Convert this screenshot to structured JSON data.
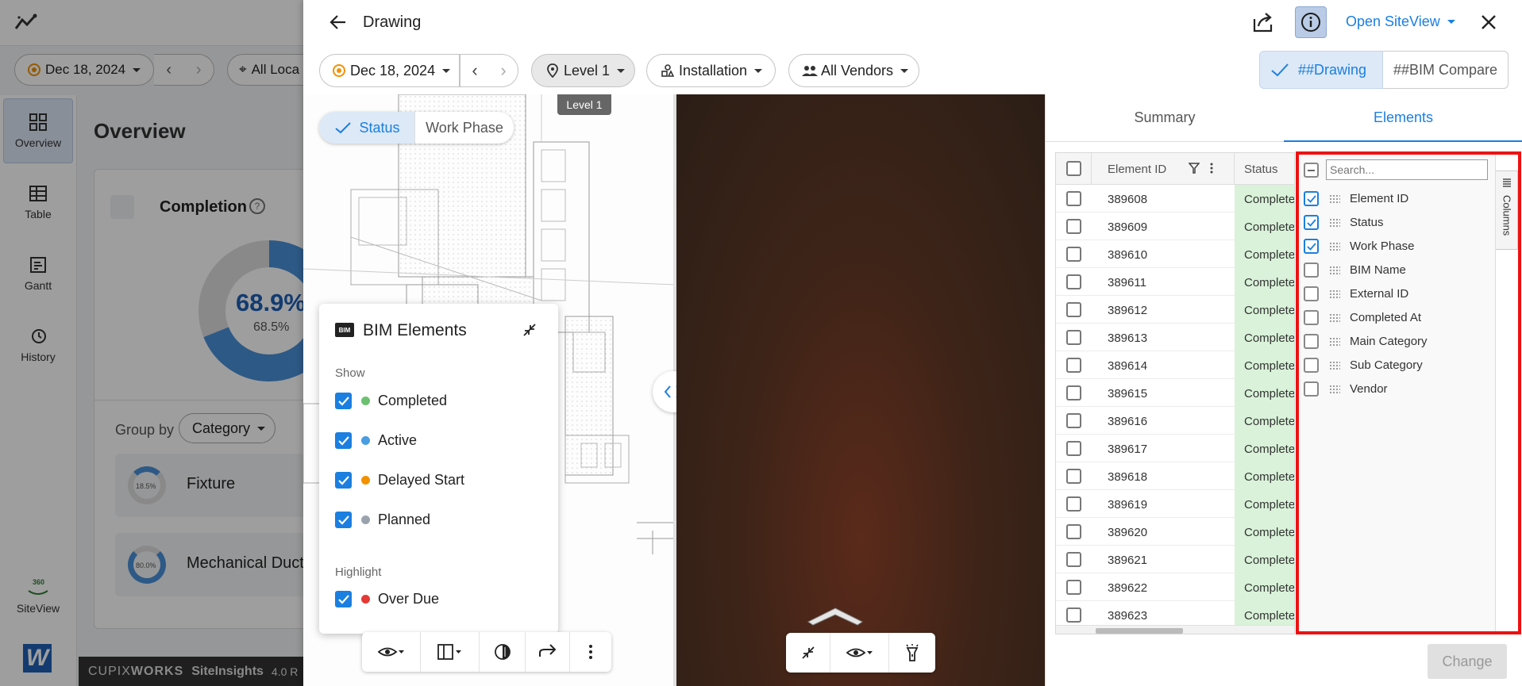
{
  "background": {
    "date": "Dec 18, 2024",
    "location_filter": "All Loca",
    "sidebar": [
      {
        "label": "Overview"
      },
      {
        "label": "Table"
      },
      {
        "label": "Gantt"
      },
      {
        "label": "History"
      },
      {
        "label": "SiteView"
      }
    ],
    "overview_title": "Overview",
    "completion_title": "Completion",
    "completion_percent": "68.9%",
    "completion_sub": "68.5%",
    "group_by_label": "Group by",
    "group_by_value": "Category",
    "groups": [
      {
        "percent": "18.5%",
        "label": "Fixture"
      },
      {
        "percent": "80.0%",
        "label": "Mechanical Duct"
      }
    ],
    "brand": "CUPIXWORKS",
    "brand_cupix": "CUPIX",
    "brand_works": "WORKS",
    "product": "SiteInsights",
    "version": "4.0 R"
  },
  "header": {
    "title": "Drawing",
    "open_siteview": "Open SiteView"
  },
  "toolbar": {
    "date": "Dec 18, 2024",
    "level": "Level 1",
    "installation": "Installation",
    "vendors": "All Vendors",
    "view_drawing": "##Drawing",
    "view_bim_compare": "##BIM Compare"
  },
  "drawing": {
    "level_tag": "Level 1",
    "mode_status": "Status",
    "mode_work_phase": "Work Phase"
  },
  "bim_popover": {
    "badge": "BIM",
    "title": "BIM Elements",
    "show_label": "Show",
    "show_items": [
      {
        "label": "Completed",
        "color": "#6cc070",
        "checked": true
      },
      {
        "label": "Active",
        "color": "#4a9de0",
        "checked": true
      },
      {
        "label": "Delayed Start",
        "color": "#f29100",
        "checked": true
      },
      {
        "label": "Planned",
        "color": "#9aa3ad",
        "checked": true
      }
    ],
    "highlight_label": "Highlight",
    "highlight_items": [
      {
        "label": "Over Due",
        "color": "#e53935",
        "checked": true
      }
    ]
  },
  "right_panel": {
    "tabs": [
      {
        "label": "Summary"
      },
      {
        "label": "Elements"
      }
    ],
    "active_tab": "Elements",
    "columns": {
      "element_id": "Element ID",
      "status": "Status"
    },
    "rows": [
      {
        "id": "389608",
        "status": "Completed"
      },
      {
        "id": "389609",
        "status": "Completed"
      },
      {
        "id": "389610",
        "status": "Completed"
      },
      {
        "id": "389611",
        "status": "Completed"
      },
      {
        "id": "389612",
        "status": "Completed"
      },
      {
        "id": "389613",
        "status": "Completed"
      },
      {
        "id": "389614",
        "status": "Completed"
      },
      {
        "id": "389615",
        "status": "Completed"
      },
      {
        "id": "389616",
        "status": "Completed"
      },
      {
        "id": "389617",
        "status": "Completed"
      },
      {
        "id": "389618",
        "status": "Completed"
      },
      {
        "id": "389619",
        "status": "Completed"
      },
      {
        "id": "389620",
        "status": "Completed"
      },
      {
        "id": "389621",
        "status": "Completed"
      },
      {
        "id": "389622",
        "status": "Completed"
      },
      {
        "id": "389623",
        "status": "Completed"
      }
    ],
    "change_button": "Change"
  },
  "columns_panel": {
    "search_placeholder": "Search...",
    "side_tab": "Columns",
    "items": [
      {
        "label": "Element ID",
        "checked": true
      },
      {
        "label": "Status",
        "checked": true
      },
      {
        "label": "Work Phase",
        "checked": true
      },
      {
        "label": "BIM Name",
        "checked": false
      },
      {
        "label": "External ID",
        "checked": false
      },
      {
        "label": "Completed At",
        "checked": false
      },
      {
        "label": "Main Category",
        "checked": false
      },
      {
        "label": "Sub Category",
        "checked": false
      },
      {
        "label": "Vendor",
        "checked": false
      }
    ]
  },
  "colors": {
    "accent": "#1a7fe0",
    "highlight_border": "#e11111",
    "status_completed_bg": "#d9f2d9"
  }
}
